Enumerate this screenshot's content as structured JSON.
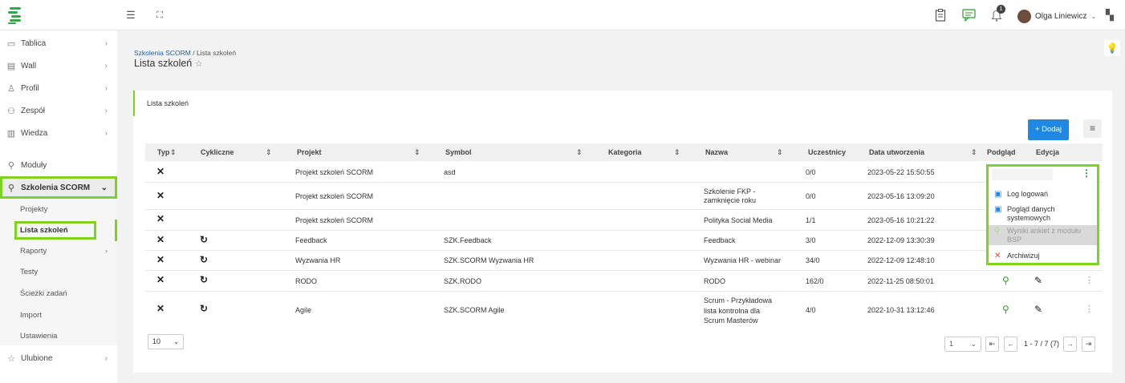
{
  "topbar": {
    "user_name": "Olga Liniewicz",
    "notifications_count": "1",
    "icons": [
      "menu-icon",
      "fullscreen-icon",
      "clipboard-icon",
      "chat-icon",
      "bell-icon",
      "grid-icon"
    ]
  },
  "sidebar": {
    "items": [
      {
        "label": "Tablica",
        "icon": "monitor-icon"
      },
      {
        "label": "Wall",
        "icon": "wall-icon"
      },
      {
        "label": "Profil",
        "icon": "user-icon"
      },
      {
        "label": "Zespół",
        "icon": "team-icon"
      },
      {
        "label": "Wiedza",
        "icon": "book-icon"
      },
      {
        "label": "Moduły",
        "icon": "wrench-icon"
      },
      {
        "label": "Szkolenia SCORM",
        "icon": "wrench-icon"
      }
    ],
    "subitems": [
      "Projekty",
      "Lista szkoleń",
      "Raporty",
      "Testy",
      "Ścieżki zadań",
      "Import",
      "Ustawienia"
    ],
    "favorites": "Ulubione"
  },
  "breadcrumb": {
    "link": "Szkolenia SCORM",
    "separator": " / ",
    "current": "Lista szkoleń"
  },
  "page_title": "Lista szkoleń",
  "card": {
    "title": "Lista szkoleń",
    "add_button": "+ Dodaj"
  },
  "table": {
    "headers": [
      "Typ",
      "Cykliczne",
      "Projekt",
      "Symbol",
      "Kategoria",
      "Nazwa",
      "Uczestnicy",
      "Data utworzenia",
      "Podgląd",
      "Edycja"
    ],
    "rows": [
      {
        "projekt": "Projekt szkoleń SCORM",
        "symbol": "asd",
        "kategoria": "",
        "nazwa": "",
        "uczestnicy": "0/0",
        "data": "2023-05-22 15:50:55"
      },
      {
        "projekt": "Projekt szkoleń SCORM",
        "symbol": "",
        "kategoria": "",
        "nazwa": "Szkolenie FKP - zamknięcie roku",
        "uczestnicy": "0/0",
        "data": "2023-05-16 13:09:20"
      },
      {
        "projekt": "Projekt szkoleń SCORM",
        "symbol": "",
        "kategoria": "",
        "nazwa": "Polityka Social Media",
        "uczestnicy": "1/1",
        "data": "2023-05-16 10:21:22"
      },
      {
        "projekt": "Feedback",
        "symbol": "SZK.Feedback",
        "kategoria": "",
        "nazwa": "Feedback",
        "uczestnicy": "3/0",
        "data": "2022-12-09 13:30:39"
      },
      {
        "projekt": "Wyzwania HR",
        "symbol": "SZK.SCORM Wyzwania HR",
        "kategoria": "",
        "nazwa": "Wyzwania HR - webinar",
        "uczestnicy": "34/0",
        "data": "2022-12-09 12:48:10"
      },
      {
        "projekt": "RODO",
        "symbol": "SZK.RODO",
        "kategoria": "",
        "nazwa": "RODO",
        "uczestnicy": "162/0",
        "data": "2022-11-25 08:50:01"
      },
      {
        "projekt": "Agile",
        "symbol": "SZK.SCORM Agile",
        "kategoria": "",
        "nazwa": "Scrum - Przykładowa lista kontrolna dla Scrum Masterów",
        "uczestnicy": "4/0",
        "data": "2022-10-31 13:12:46"
      }
    ]
  },
  "dropdown": {
    "items": [
      {
        "label": "Log logowań",
        "icon": "log-icon"
      },
      {
        "label": "Pogląd danych systemowych",
        "icon": "system-data-icon"
      },
      {
        "label": "Wyniki ankiet z modułu BSP",
        "icon": "search-icon"
      },
      {
        "label": "Archiwizuj",
        "icon": "close-icon"
      }
    ]
  },
  "pagination": {
    "page_size": "10",
    "page": "1",
    "summary": "1 - 7 / 7 (7)"
  },
  "colors": {
    "accent": "#7ed321",
    "primary": "#1e88e5",
    "view_green": "#2e9b2e"
  }
}
